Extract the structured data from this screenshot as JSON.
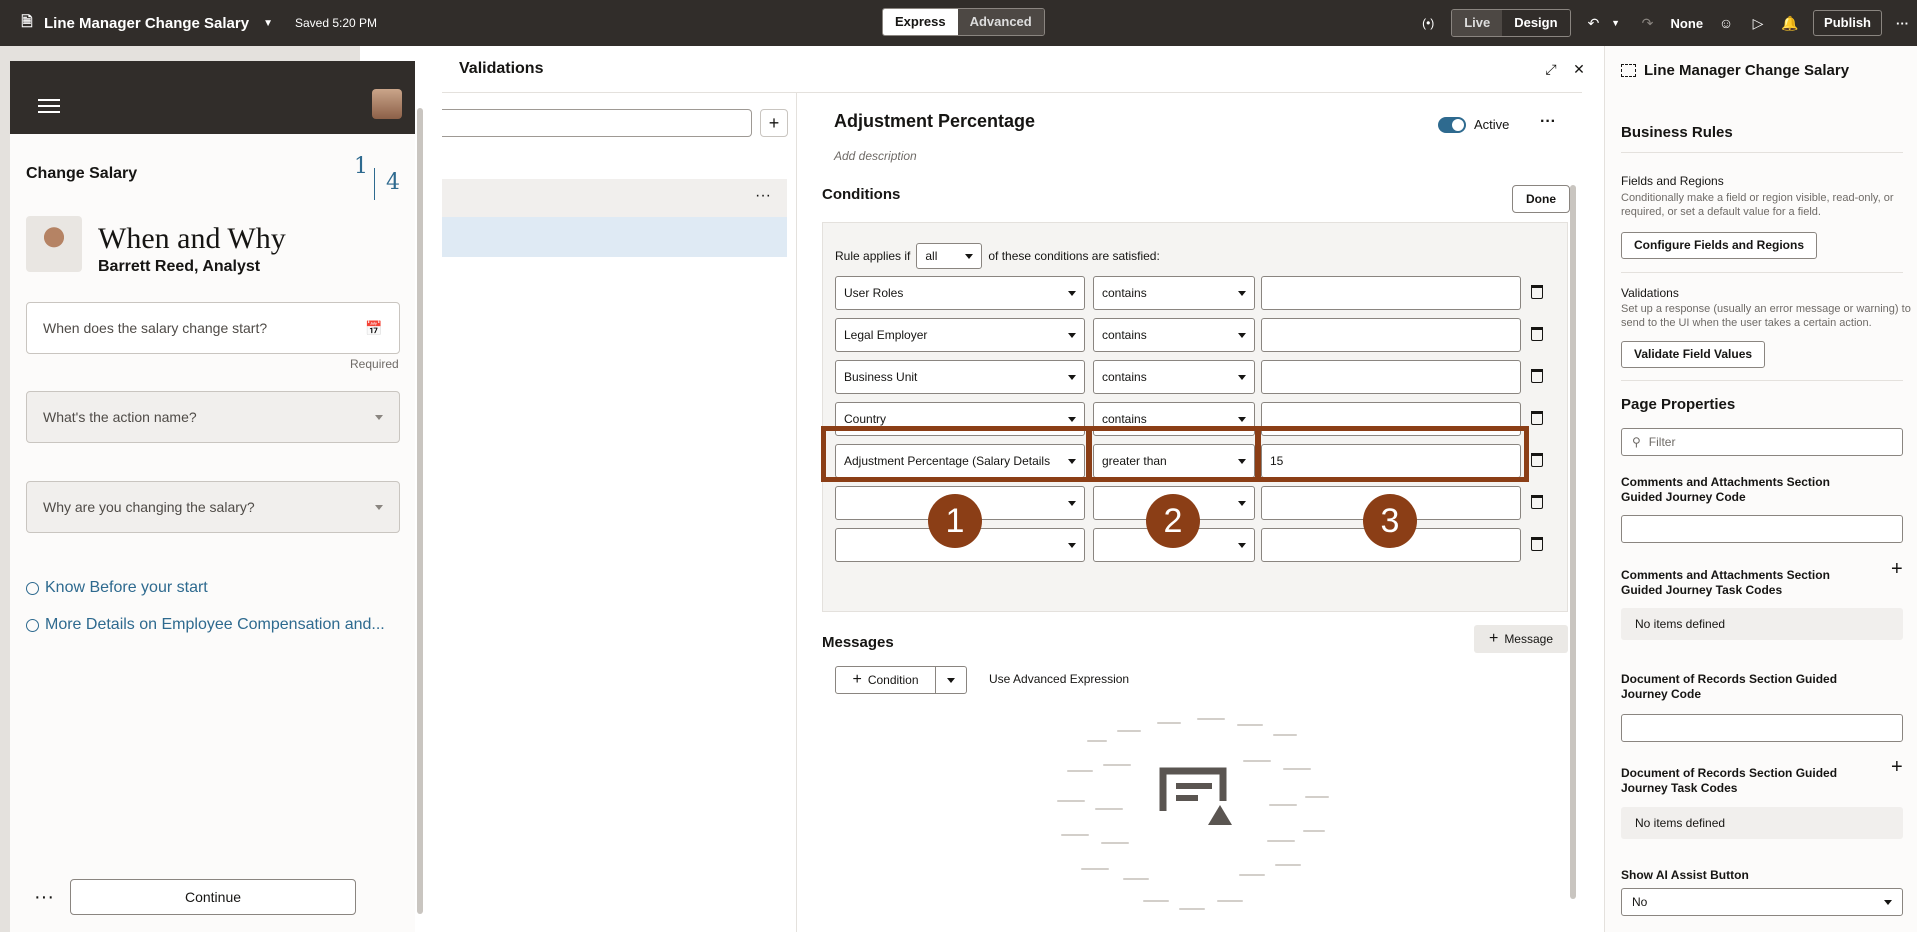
{
  "topbar": {
    "title": "Line Manager Change Salary",
    "saved": "Saved 5:20 PM",
    "modes": [
      "Express",
      "Advanced"
    ],
    "views": [
      "Live",
      "Design"
    ],
    "none_label": "None",
    "publish": "Publish"
  },
  "preview": {
    "title": "Change Salary",
    "step_current": "1",
    "step_total": "4",
    "heading": "When and Why",
    "person": "Barrett Reed, Analyst",
    "date_field": "When does the salary change start?",
    "required": "Required",
    "action_field": "What's the action name?",
    "reason_field": "Why are you changing the salary?",
    "links": [
      "Know Before your start",
      "More Details on Employee Compensation and..."
    ],
    "continue": "Continue"
  },
  "validations": {
    "title": "Validations",
    "rule_title": "Adjustment Percentage",
    "active_label": "Active",
    "add_description": "Add description",
    "conditions_label": "Conditions",
    "done": "Done",
    "rule_applies_prefix": "Rule applies if",
    "rule_applies_value": "all",
    "rule_applies_suffix": "of these conditions are satisfied:",
    "rows": [
      {
        "field": "User Roles",
        "op": "contains",
        "value": ""
      },
      {
        "field": "Legal Employer",
        "op": "contains",
        "value": ""
      },
      {
        "field": "Business Unit",
        "op": "contains",
        "value": ""
      },
      {
        "field": "Country",
        "op": "contains",
        "value": ""
      },
      {
        "field": "Adjustment Percentage (Salary Details",
        "op": "greater than",
        "value": "15"
      },
      {
        "field": "",
        "op": "",
        "value": ""
      },
      {
        "field": "",
        "op": "",
        "value": ""
      }
    ],
    "condition_button": "Condition",
    "advanced_expression": "Use Advanced Expression",
    "messages_label": "Messages",
    "message_button": "Message",
    "badges": [
      "1",
      "2",
      "3"
    ]
  },
  "right": {
    "title": "Line Manager Change Salary",
    "business_rules": "Business Rules",
    "fields_regions": "Fields and Regions",
    "fields_regions_desc": "Conditionally make a field or region visible, read-only, or required, or set a default value for a field.",
    "configure_btn": "Configure Fields and Regions",
    "validations": "Validations",
    "validations_desc": "Set up a response (usually an error message or warning) to send to the UI when the user takes a certain action.",
    "validate_btn": "Validate Field Values",
    "page_properties": "Page Properties",
    "filter_placeholder": "Filter",
    "p1": "Comments and Attachments Section Guided Journey Code",
    "p2": "Comments and Attachments Section Guided Journey Task Codes",
    "no_items": "No items defined",
    "p3": "Document of Records Section Guided Journey Code",
    "p4": "Document of Records Section Guided Journey Task Codes",
    "p5": "Show AI Assist Button",
    "ai_value": "No"
  }
}
